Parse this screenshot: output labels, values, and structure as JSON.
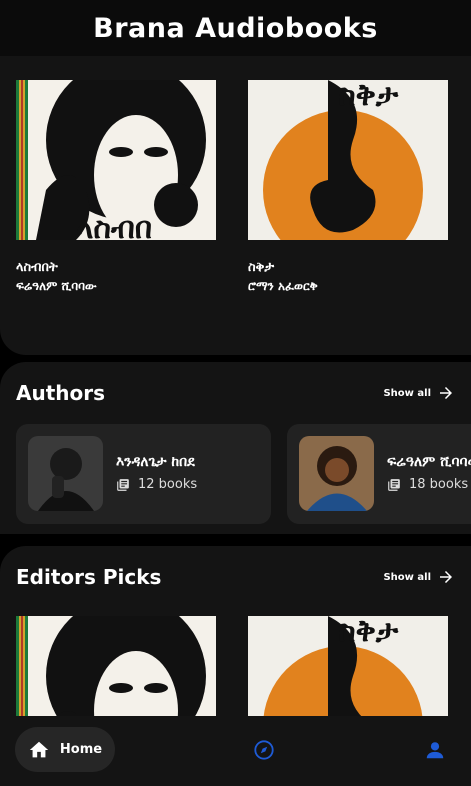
{
  "app": {
    "title": "Brana Audiobooks"
  },
  "top_books": [
    {
      "title": "ላስብበት",
      "author": "ፍሬዓለም ሺባባው"
    },
    {
      "title": "ስቅታ",
      "author": "ሮማን አፈወርቅ"
    }
  ],
  "authors": {
    "title": "Authors",
    "show_all": "Show all",
    "items": [
      {
        "name": "እንዳለጌታ ከበደ",
        "books": "12 books"
      },
      {
        "name": "ፍሬዓለም ሺባባው",
        "books": "18 books"
      }
    ]
  },
  "editors": {
    "title": "Editors Picks",
    "show_all": "Show all"
  },
  "nav": {
    "home": "Home"
  },
  "colors": {
    "background": "#000000",
    "surface": "#141414",
    "card": "#222222",
    "accent": "#e1821e"
  }
}
